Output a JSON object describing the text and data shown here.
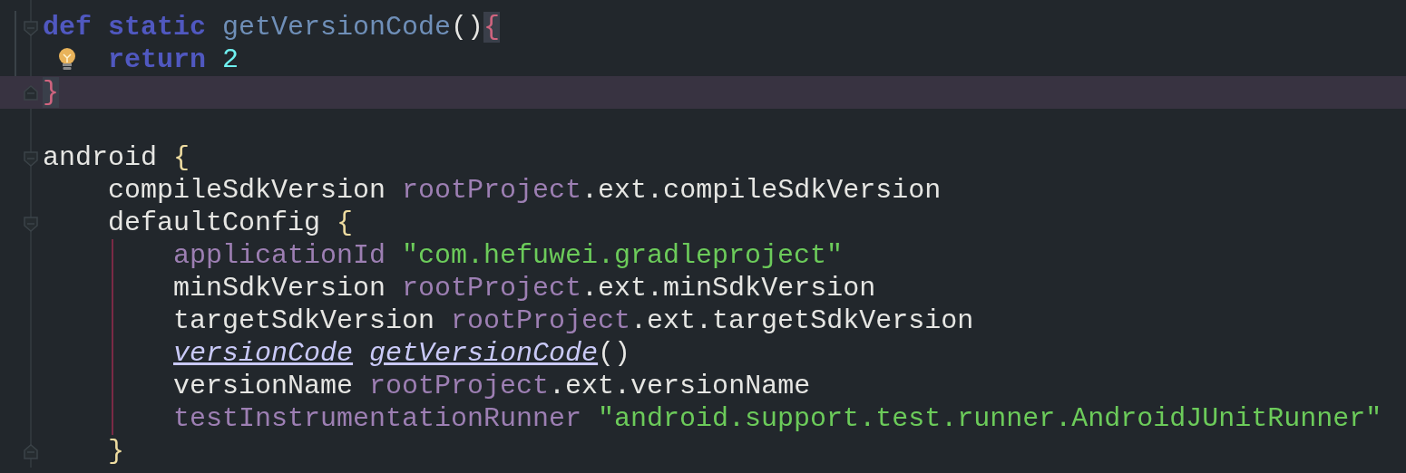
{
  "editor": {
    "lines": [
      {
        "current": false,
        "fold_start": true,
        "fold_end": false,
        "intention_bulb": false,
        "words": [
          [
            {
              "text": "def",
              "kind": "keyword"
            }
          ],
          [
            {
              "text": "static",
              "kind": "keyword"
            }
          ],
          [
            {
              "text": "getVersionCode",
              "kind": "method"
            },
            {
              "text": "()",
              "kind": "plain"
            },
            {
              "text": "{",
              "kind": "matched_brace"
            }
          ]
        ],
        "children": [
          {
            "current": false,
            "fold_start": false,
            "fold_end": false,
            "intention_bulb": true,
            "words": [
              [
                {
                  "text": "return",
                  "kind": "keyword"
                }
              ],
              [
                {
                  "text": "2",
                  "kind": "number"
                }
              ]
            ]
          }
        ]
      },
      {
        "current": true,
        "fold_start": false,
        "fold_end": true,
        "intention_bulb": false,
        "words": [
          [
            {
              "text": "}",
              "kind": "matched_brace"
            }
          ]
        ]
      },
      {
        "current": false,
        "fold_start": false,
        "fold_end": false,
        "intention_bulb": false
      },
      {
        "current": false,
        "fold_start": true,
        "fold_end": false,
        "intention_bulb": false,
        "words": [
          [
            {
              "text": "android",
              "kind": "plain"
            }
          ],
          [
            {
              "text": "{",
              "kind": "brace"
            }
          ]
        ],
        "children": [
          {
            "current": false,
            "fold_start": false,
            "fold_end": false,
            "intention_bulb": false,
            "words": [
              [
                {
                  "text": "compileSdkVersion",
                  "kind": "plain"
                }
              ],
              [
                {
                  "text": "rootProject",
                  "kind": "field"
                },
                {
                  "text": ".ext.compileSdkVersion",
                  "kind": "plain"
                }
              ]
            ]
          },
          {
            "current": false,
            "fold_start": true,
            "fold_end": false,
            "intention_bulb": false,
            "guide": true,
            "words": [
              [
                {
                  "text": "defaultConfig",
                  "kind": "plain"
                }
              ],
              [
                {
                  "text": "{",
                  "kind": "brace"
                }
              ]
            ],
            "children": [
              {
                "current": false,
                "fold_start": false,
                "fold_end": false,
                "intention_bulb": false,
                "words": [
                  [
                    {
                      "text": "applicationId",
                      "kind": "field"
                    }
                  ],
                  [
                    {
                      "text": "\"com.hefuwei.gradleproject\"",
                      "kind": "string"
                    }
                  ]
                ]
              },
              {
                "current": false,
                "fold_start": false,
                "fold_end": false,
                "intention_bulb": false,
                "words": [
                  [
                    {
                      "text": "minSdkVersion",
                      "kind": "plain"
                    }
                  ],
                  [
                    {
                      "text": "rootProject",
                      "kind": "field"
                    },
                    {
                      "text": ".ext.minSdkVersion",
                      "kind": "plain"
                    }
                  ]
                ]
              },
              {
                "current": false,
                "fold_start": false,
                "fold_end": false,
                "intention_bulb": false,
                "words": [
                  [
                    {
                      "text": "targetSdkVersion",
                      "kind": "plain"
                    }
                  ],
                  [
                    {
                      "text": "rootProject",
                      "kind": "field"
                    },
                    {
                      "text": ".ext.targetSdkVersion",
                      "kind": "plain"
                    }
                  ]
                ]
              },
              {
                "current": false,
                "fold_start": false,
                "fold_end": false,
                "intention_bulb": false,
                "words": [
                  [
                    {
                      "text": "versionCode",
                      "kind": "dynamic"
                    }
                  ],
                  [
                    {
                      "text": "getVersionCode",
                      "kind": "dynamic"
                    },
                    {
                      "text": "()",
                      "kind": "plain"
                    }
                  ]
                ]
              },
              {
                "current": false,
                "fold_start": false,
                "fold_end": false,
                "intention_bulb": false,
                "words": [
                  [
                    {
                      "text": "versionName",
                      "kind": "plain"
                    }
                  ],
                  [
                    {
                      "text": "rootProject",
                      "kind": "field"
                    },
                    {
                      "text": ".ext.versionName",
                      "kind": "plain"
                    }
                  ]
                ]
              },
              {
                "current": false,
                "fold_start": false,
                "fold_end": false,
                "intention_bulb": false,
                "words": [
                  [
                    {
                      "text": "testInstrumentationRunner",
                      "kind": "field"
                    }
                  ],
                  [
                    {
                      "text": "\"android.support.test.runner.AndroidJUnitRunner\"",
                      "kind": "string"
                    }
                  ]
                ]
              }
            ]
          },
          {
            "current": false,
            "fold_start": false,
            "fold_end": true,
            "intention_bulb": false,
            "words": [
              [
                {
                  "text": "}",
                  "kind": "brace"
                }
              ]
            ]
          }
        ]
      }
    ]
  }
}
